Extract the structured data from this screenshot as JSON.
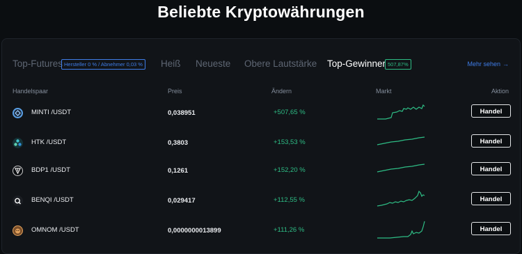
{
  "page_title": "Beliebte Kryptowährungen",
  "tabs": [
    {
      "label": "Top-Futures",
      "badge": "Hersteller 0 % / Abnehmer 0,03 %"
    },
    {
      "label": "Heiß"
    },
    {
      "label": "Neueste"
    },
    {
      "label": "Obere Lautstärke"
    },
    {
      "label": "Top-Gewinner",
      "badge": "507,87%",
      "active": true
    }
  ],
  "more_link": "Mehr sehen",
  "columns": {
    "pair": "Handelspaar",
    "price": "Preis",
    "change": "Ändern",
    "market": "Markt",
    "action": "Aktion"
  },
  "rows": [
    {
      "pair": "MINTI /USDT",
      "price": "0,038951",
      "change": "+507,65 %",
      "button": "Handel",
      "icon": "minti-coin-icon",
      "icon_color": "#5aa0e6"
    },
    {
      "pair": "HTK /USDT",
      "price": "0,3803",
      "change": "+153,53 %",
      "button": "Handel",
      "icon": "htk-coin-icon",
      "icon_color": "#3fc1c9"
    },
    {
      "pair": "BDP1 /USDT",
      "price": "0,1261",
      "change": "+152,20 %",
      "button": "Handel",
      "icon": "bdp1-coin-icon",
      "icon_color": "#cccccc"
    },
    {
      "pair": "BENQI /USDT",
      "price": "0,029417",
      "change": "+112,55 %",
      "button": "Handel",
      "icon": "benqi-coin-icon",
      "icon_color": "#ffffff"
    },
    {
      "pair": "OMNOM /USDT",
      "price": "0,0000000013899",
      "change": "+111,26 %",
      "button": "Handel",
      "icon": "omnom-coin-icon",
      "icon_color": "#e2a15c"
    }
  ],
  "colors": {
    "positive": "#2ebd85",
    "link": "#3f7de8",
    "background": "#0b0e11"
  }
}
